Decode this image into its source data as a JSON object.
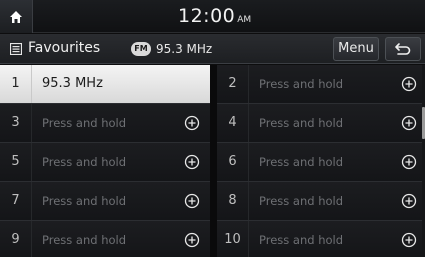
{
  "status": {
    "time": "12:00",
    "ampm": "AM"
  },
  "header": {
    "title": "Favourites",
    "band_badge": "FM",
    "frequency": "95.3 MHz",
    "menu_label": "Menu"
  },
  "presets": [
    {
      "num": "1",
      "label": "95.3 MHz",
      "active": true
    },
    {
      "num": "2",
      "label": "Press and hold"
    },
    {
      "num": "3",
      "label": "Press and hold"
    },
    {
      "num": "4",
      "label": "Press and hold"
    },
    {
      "num": "5",
      "label": "Press and hold"
    },
    {
      "num": "6",
      "label": "Press and hold"
    },
    {
      "num": "7",
      "label": "Press and hold"
    },
    {
      "num": "8",
      "label": "Press and hold"
    },
    {
      "num": "9",
      "label": "Press and hold"
    },
    {
      "num": "10",
      "label": "Press and hold"
    }
  ],
  "icons": {
    "home": "home-icon",
    "list": "list-icon",
    "back": "back-icon",
    "add": "add-circle-icon"
  }
}
